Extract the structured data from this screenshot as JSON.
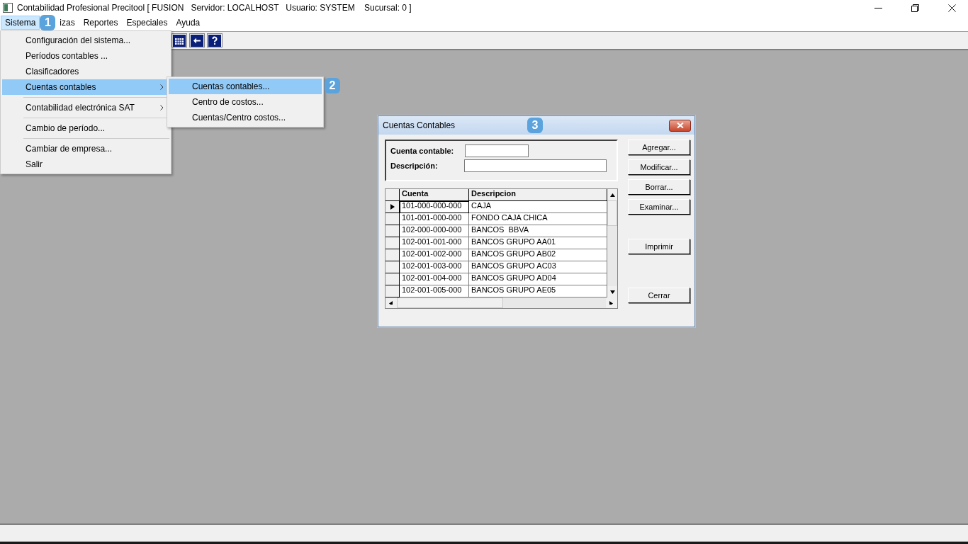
{
  "window": {
    "title": "Contabilidad Profesional Precitool [ FUSION   Servidor: LOCALHOST   Usuario: SYSTEM    Sucursal: 0 ]"
  },
  "menu_bar": [
    {
      "label": "Sistema",
      "selected": true
    },
    {
      "label": "izas",
      "selected": false
    },
    {
      "label": "Reportes",
      "selected": false
    },
    {
      "label": "Especiales",
      "selected": false
    },
    {
      "label": "Ayuda",
      "selected": false
    }
  ],
  "callouts": [
    "1",
    "2",
    "3"
  ],
  "toolbar": [
    {
      "kind": "calendar"
    },
    {
      "kind": "back"
    },
    {
      "kind": "help"
    }
  ],
  "sistema_menu": [
    {
      "kind": "item",
      "label": "Configuración del sistema...",
      "selected": false,
      "submenu": false
    },
    {
      "kind": "item",
      "label": "Períodos contables ...",
      "selected": false,
      "submenu": false
    },
    {
      "kind": "item",
      "label": "Clasificadores",
      "selected": false,
      "submenu": false
    },
    {
      "kind": "item",
      "label": "Cuentas contables",
      "selected": true,
      "submenu": true
    },
    {
      "kind": "separator"
    },
    {
      "kind": "item",
      "label": "Contabilidad electrónica SAT",
      "selected": false,
      "submenu": true
    },
    {
      "kind": "separator"
    },
    {
      "kind": "item",
      "label": "Cambio de período...",
      "selected": false,
      "submenu": false
    },
    {
      "kind": "separator"
    },
    {
      "kind": "item",
      "label": "Cambiar de empresa...",
      "selected": false,
      "submenu": false
    },
    {
      "kind": "item",
      "label": "Salir",
      "selected": false,
      "submenu": false
    }
  ],
  "submenu": [
    {
      "label": "Cuentas contables...",
      "selected": true
    },
    {
      "label": "Centro de costos...",
      "selected": false
    },
    {
      "label": "Cuentas/Centro costos...",
      "selected": false
    }
  ],
  "dialog": {
    "title": "Cuentas Contables",
    "filters": [
      {
        "label": "Cuenta contable:",
        "kind": "short"
      },
      {
        "label": "Descripción:",
        "kind": "long"
      }
    ],
    "table": {
      "columns": [
        "Cuenta",
        "Descripcion"
      ],
      "rows": [
        {
          "cells": [
            "101-000-000-000",
            "CAJA"
          ],
          "selected": true
        },
        {
          "cells": [
            "101-001-000-000",
            "FONDO CAJA CHICA"
          ],
          "selected": false
        },
        {
          "cells": [
            "102-000-000-000",
            "BANCOS  BBVA"
          ],
          "selected": false
        },
        {
          "cells": [
            "102-001-001-000",
            "BANCOS GRUPO AA01"
          ],
          "selected": false
        },
        {
          "cells": [
            "102-001-002-000",
            "BANCOS GRUPO AB02"
          ],
          "selected": false
        },
        {
          "cells": [
            "102-001-003-000",
            "BANCOS GRUPO AC03"
          ],
          "selected": false
        },
        {
          "cells": [
            "102-001-004-000",
            "BANCOS GRUPO AD04"
          ],
          "selected": false
        },
        {
          "cells": [
            "102-001-005-000",
            "BANCOS GRUPO AE05"
          ],
          "selected": false
        }
      ]
    },
    "buttons": [
      {
        "label": "Agregar...",
        "kind": "action"
      },
      {
        "label": "Modificar...",
        "kind": "action"
      },
      {
        "label": "Borrar...",
        "kind": "action"
      },
      {
        "label": "Examinar...",
        "kind": "action"
      },
      {
        "label": "Imprimir",
        "kind": "print"
      },
      {
        "label": "Cerrar",
        "kind": "close"
      }
    ]
  }
}
